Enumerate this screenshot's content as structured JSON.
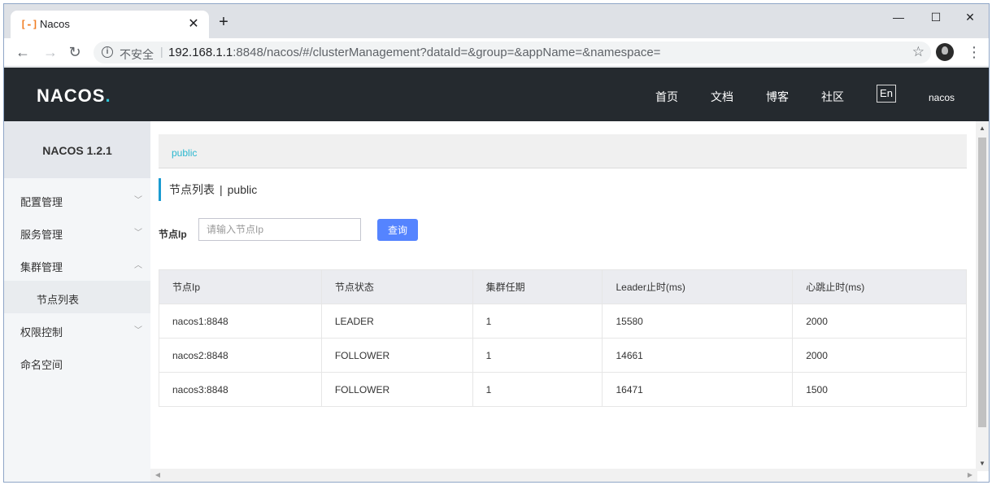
{
  "browser": {
    "tab_title": "Nacos",
    "tab_favicon": "[-]",
    "tab_close": "✕",
    "new_tab": "+",
    "win_minimize": "—",
    "win_maximize": "☐",
    "win_close": "✕",
    "insecure_label": "不安全",
    "url_host": "192.168.1.1",
    "url_rest": ":8848/nacos/#/clusterManagement?dataId=&group=&appName=&namespace=",
    "info_icon": "i",
    "star_icon": "☆",
    "menu_icon": "⋮",
    "back_icon": "←",
    "forward_icon": "→",
    "reload_icon": "↻"
  },
  "header": {
    "logo_main": "NACOS",
    "logo_dot": ".",
    "nav": [
      "首页",
      "文档",
      "博客",
      "社区"
    ],
    "lang_toggle": "En",
    "user": "nacos"
  },
  "sidebar": {
    "version": "NACOS 1.2.1",
    "items": [
      {
        "label": "配置管理",
        "chevron": "﹀"
      },
      {
        "label": "服务管理",
        "chevron": "﹀"
      },
      {
        "label": "集群管理",
        "chevron": "︿"
      },
      {
        "label": "节点列表",
        "chevron": ""
      },
      {
        "label": "权限控制",
        "chevron": "﹀"
      },
      {
        "label": "命名空间",
        "chevron": ""
      }
    ]
  },
  "main": {
    "namespace": "public",
    "title": "节点列表",
    "title_pipe": "|",
    "title_ns": "public",
    "filter_label": "节点Ip",
    "filter_placeholder": "请输入节点Ip",
    "filter_value": "",
    "query_button": "查询",
    "table": {
      "headers": [
        "节点Ip",
        "节点状态",
        "集群任期",
        "Leader止时(ms)",
        "心跳止时(ms)"
      ],
      "rows": [
        [
          "nacos1:8848",
          "LEADER",
          "1",
          "15580",
          "2000"
        ],
        [
          "nacos2:8848",
          "FOLLOWER",
          "1",
          "14661",
          "2000"
        ],
        [
          "nacos3:8848",
          "FOLLOWER",
          "1",
          "16471",
          "1500"
        ]
      ]
    }
  },
  "scroll": {
    "up": "▲",
    "down": "▼",
    "left": "◀",
    "right": "▶"
  }
}
